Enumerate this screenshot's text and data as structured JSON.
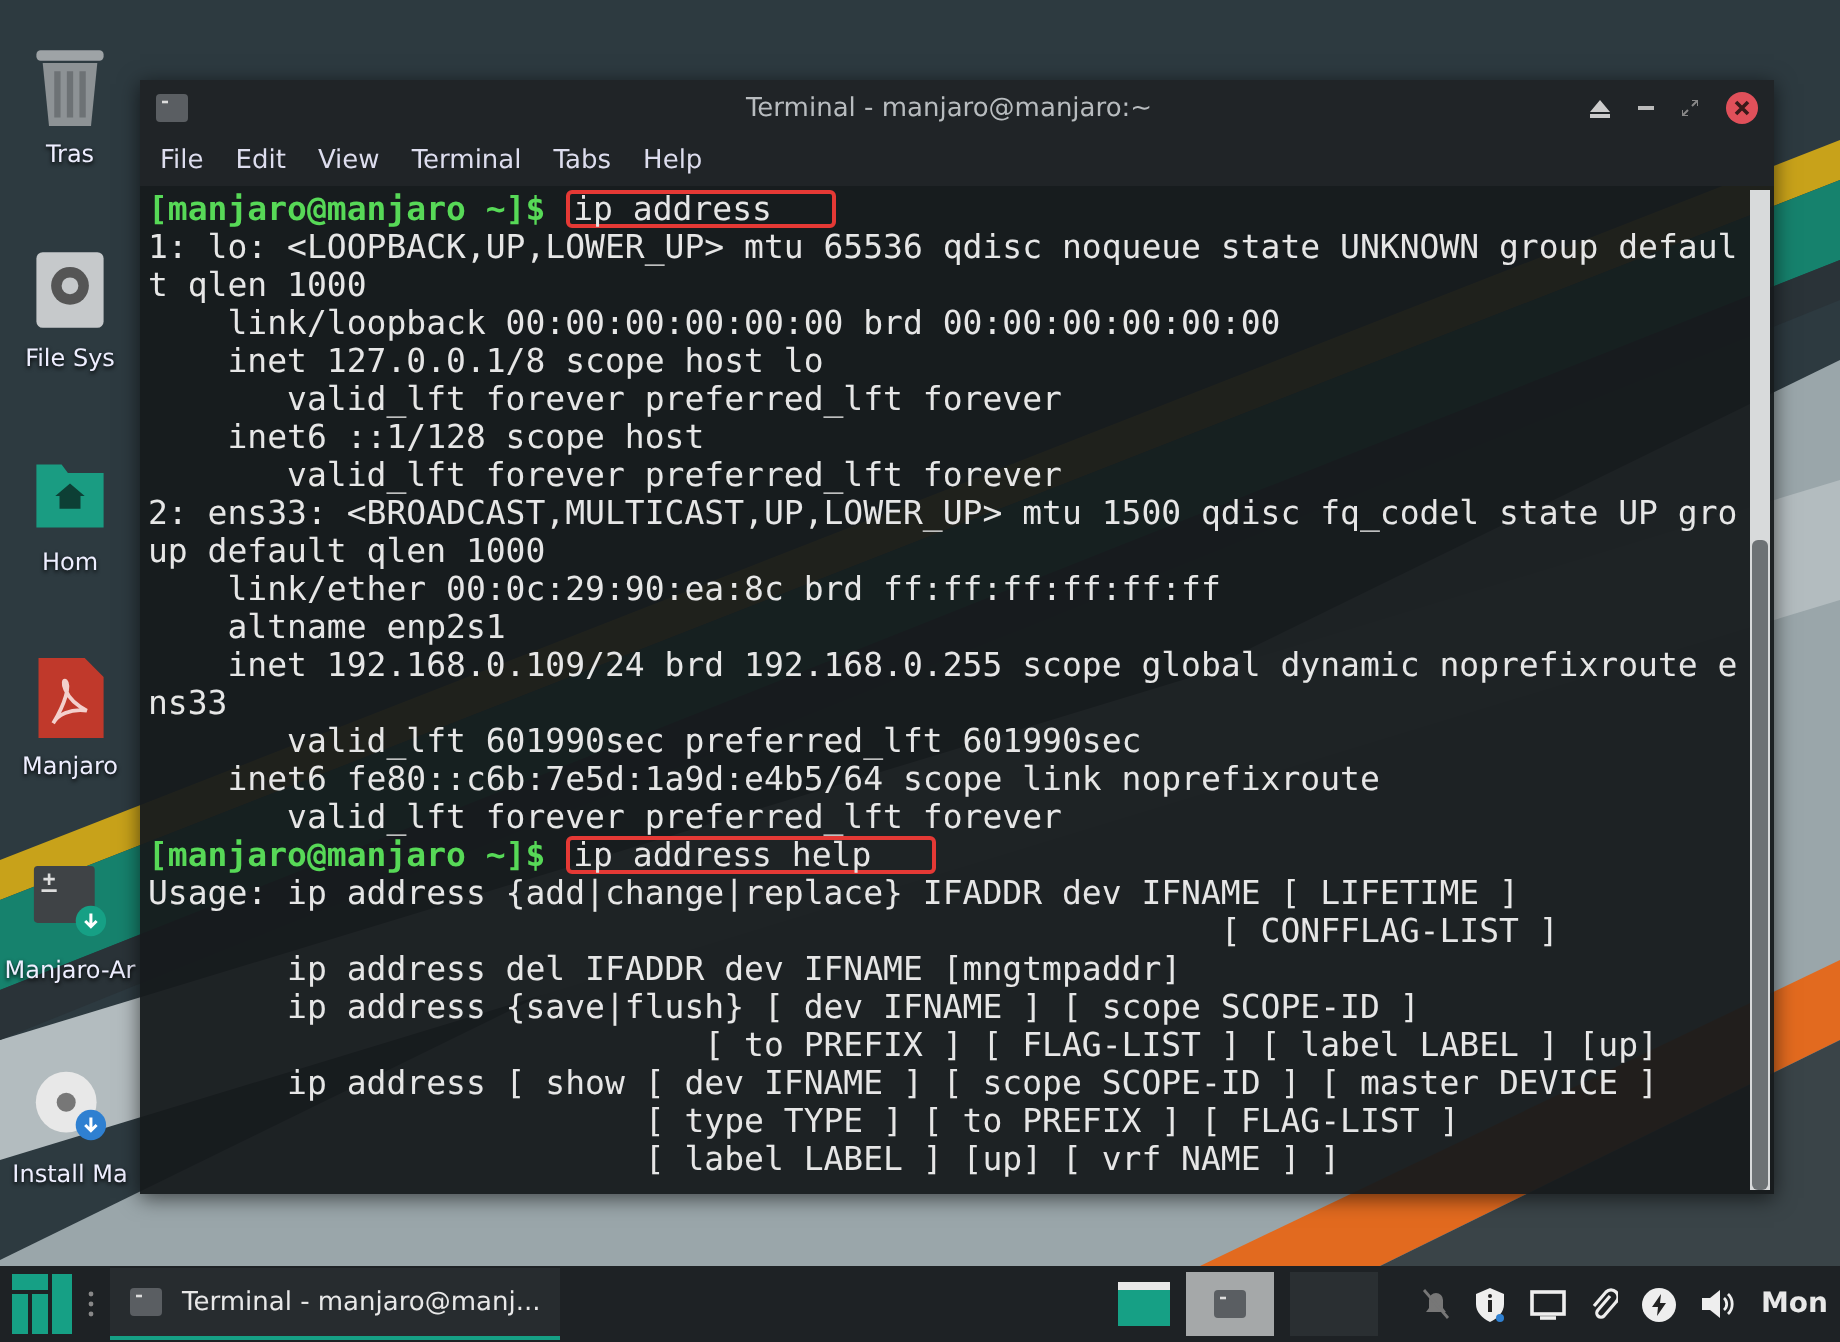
{
  "desktop": {
    "icons": [
      {
        "label": "Tras",
        "kind": "trash"
      },
      {
        "label": "File Sys",
        "kind": "drive"
      },
      {
        "label": "Hom",
        "kind": "home"
      },
      {
        "label": "Manjaro",
        "kind": "pdf"
      },
      {
        "label": "Manjaro-Ar",
        "kind": "script"
      },
      {
        "label": "Install Ma",
        "kind": "disc"
      }
    ]
  },
  "window": {
    "title": "Terminal - manjaro@manjaro:~",
    "menu": [
      "File",
      "Edit",
      "View",
      "Terminal",
      "Tabs",
      "Help"
    ],
    "lines": [
      {
        "kind": "prompt",
        "prompt": "[manjaro@manjaro ~]$",
        "command": "ip address",
        "highlighted": true
      },
      {
        "kind": "output",
        "text": "1: lo: <LOOPBACK,UP,LOWER_UP> mtu 65536 qdisc noqueue state UNKNOWN group defaul"
      },
      {
        "kind": "output",
        "text": "t qlen 1000"
      },
      {
        "kind": "output",
        "text": "    link/loopback 00:00:00:00:00:00 brd 00:00:00:00:00:00"
      },
      {
        "kind": "output",
        "text": "    inet 127.0.0.1/8 scope host lo"
      },
      {
        "kind": "output",
        "text": "       valid_lft forever preferred_lft forever"
      },
      {
        "kind": "output",
        "text": "    inet6 ::1/128 scope host"
      },
      {
        "kind": "output",
        "text": "       valid_lft forever preferred_lft forever"
      },
      {
        "kind": "output",
        "text": "2: ens33: <BROADCAST,MULTICAST,UP,LOWER_UP> mtu 1500 qdisc fq_codel state UP gro"
      },
      {
        "kind": "output",
        "text": "up default qlen 1000"
      },
      {
        "kind": "output",
        "text": "    link/ether 00:0c:29:90:ea:8c brd ff:ff:ff:ff:ff:ff"
      },
      {
        "kind": "output",
        "text": "    altname enp2s1"
      },
      {
        "kind": "output",
        "text": "    inet 192.168.0.109/24 brd 192.168.0.255 scope global dynamic noprefixroute e"
      },
      {
        "kind": "output",
        "text": "ns33"
      },
      {
        "kind": "output",
        "text": "       valid_lft 601990sec preferred_lft 601990sec"
      },
      {
        "kind": "output",
        "text": "    inet6 fe80::c6b:7e5d:1a9d:e4b5/64 scope link noprefixroute"
      },
      {
        "kind": "output",
        "text": "       valid_lft forever preferred_lft forever"
      },
      {
        "kind": "prompt",
        "prompt": "[manjaro@manjaro ~]$",
        "command": "ip address help",
        "highlighted": true
      },
      {
        "kind": "output",
        "text": "Usage: ip address {add|change|replace} IFADDR dev IFNAME [ LIFETIME ]"
      },
      {
        "kind": "output",
        "text": "                                                      [ CONFFLAG-LIST ]"
      },
      {
        "kind": "output",
        "text": "       ip address del IFADDR dev IFNAME [mngtmpaddr]"
      },
      {
        "kind": "output",
        "text": "       ip address {save|flush} [ dev IFNAME ] [ scope SCOPE-ID ]"
      },
      {
        "kind": "output",
        "text": "                            [ to PREFIX ] [ FLAG-LIST ] [ label LABEL ] [up]"
      },
      {
        "kind": "output",
        "text": "       ip address [ show [ dev IFNAME ] [ scope SCOPE-ID ] [ master DEVICE ]"
      },
      {
        "kind": "output",
        "text": "                         [ type TYPE ] [ to PREFIX ] [ FLAG-LIST ]"
      },
      {
        "kind": "output",
        "text": "                         [ label LABEL ] [up] [ vrf NAME ] ]"
      }
    ]
  },
  "taskbar": {
    "task": {
      "label": "Terminal - manjaro@manj...",
      "selected": true
    },
    "workspaces": [
      {
        "selected": true
      },
      {
        "selected": false
      }
    ],
    "clock": "Mon"
  }
}
